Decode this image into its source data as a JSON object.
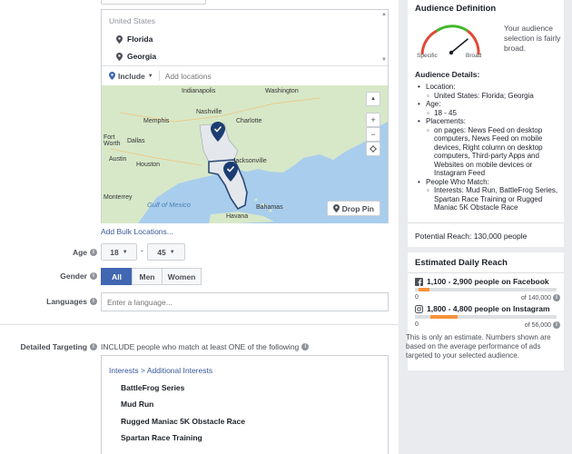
{
  "locations": {
    "country": "United States",
    "items": [
      "Florida",
      "Georgia"
    ],
    "include_label": "Include",
    "placeholder": "Add locations",
    "drop_pin": "Drop Pin",
    "add_bulk": "Add Bulk Locations..."
  },
  "map": {
    "cities": [
      "Indianapolis",
      "Washington",
      "Nashville",
      "Memphis",
      "Charlotte",
      "Fort Worth",
      "Dallas",
      "Austin",
      "Houston",
      "Jacksonville",
      "Monterrey",
      "Gulf of Mexico",
      "Bahamas",
      "Havana"
    ],
    "zoom_in": "+",
    "zoom_out": "−"
  },
  "age": {
    "label": "Age",
    "min": "18",
    "max": "45",
    "dash": "-"
  },
  "gender": {
    "label": "Gender",
    "options": [
      "All",
      "Men",
      "Women"
    ],
    "selected": "All"
  },
  "languages": {
    "label": "Languages",
    "placeholder": "Enter a language..."
  },
  "detailed_targeting": {
    "label": "Detailed Targeting",
    "description": "INCLUDE people who match at least ONE of the following",
    "path": "Interests > Additional Interests",
    "items": [
      "BattleFrog Series",
      "Mud Run",
      "Rugged Maniac 5K Obstacle Race",
      "Spartan Race Training"
    ]
  },
  "audience_definition": {
    "title": "Audience Definition",
    "description": "Your audience selection is fairly broad.",
    "specific": "Specific",
    "broad": "Broad",
    "gauge_level": 0.78
  },
  "audience_details": {
    "title": "Audience Details:",
    "location_label": "Location:",
    "location_value": "United States: Florida; Georgia",
    "age_label": "Age:",
    "age_value": "18 - 45",
    "placements_label": "Placements:",
    "placements_value": "on pages: News Feed on desktop computers, News Feed on mobile devices, Right column on desktop computers, Third-party Apps and Websites on mobile devices or Instagram Feed",
    "match_label": "People Who Match:",
    "match_value": "Interests: Mud Run, BattleFrog Series, Spartan Race Training or Rugged Maniac 5K Obstacle Race"
  },
  "potential_reach": "Potential Reach: 130,000 people",
  "estimated_daily_reach": {
    "title": "Estimated Daily Reach",
    "facebook": {
      "text": "1,100 - 2,900 people on Facebook",
      "min": "0",
      "max": "of 140,000",
      "fill_start": 0.008,
      "fill_end": 0.021
    },
    "instagram": {
      "text": "1,800 - 4,800 people on Instagram",
      "min": "0",
      "max": "of 56,000",
      "fill_start": 0.032,
      "fill_end": 0.086
    },
    "note": "This is only an estimate. Numbers shown are based on the average performance of ads targeted to your selected audience."
  },
  "colors": {
    "accent": "#4267b2",
    "link": "#365899",
    "bar": "#f7923b",
    "pin": "#1c3d72",
    "selected_region": "#e4e8ec"
  }
}
